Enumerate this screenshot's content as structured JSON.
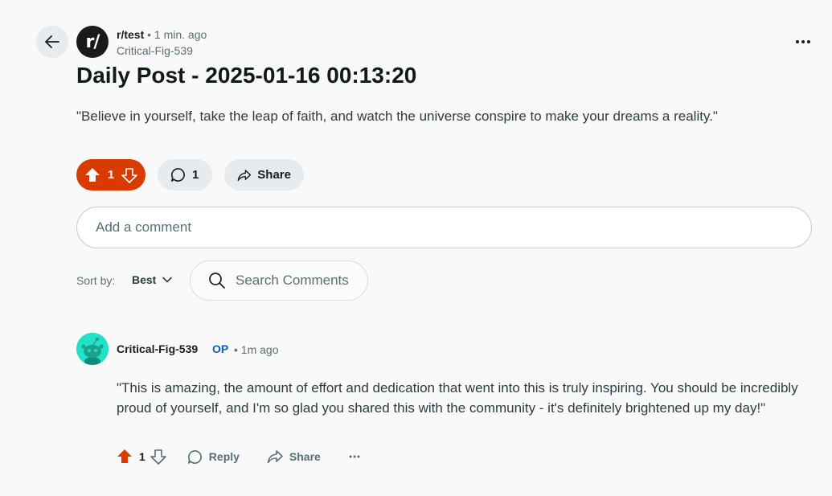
{
  "header": {
    "subreddit": "r/test",
    "separator": "•",
    "time": "1 min. ago",
    "author": "Critical-Fig-539",
    "avatar_text": "r/"
  },
  "post": {
    "title": "Daily Post - 2025-01-16 00:13:20",
    "body": "\"Believe in yourself, take the leap of faith, and watch the universe conspire to make your dreams a reality.\"",
    "votes": "1",
    "comments": "1",
    "share_label": "Share"
  },
  "comment_input": {
    "placeholder": "Add a comment"
  },
  "sort": {
    "label": "Sort by:",
    "value": "Best"
  },
  "search_comments": {
    "placeholder": "Search Comments"
  },
  "comment": {
    "author": "Critical-Fig-539",
    "op_badge": "OP",
    "separator": "•",
    "time": "1m ago",
    "body": "\"This is amazing, the amount of effort and dedication that went into this is truly inspiring. You should be incredibly proud of yourself, and I'm so glad you shared this with the community - it's definitely brightened up my day!\"",
    "votes": "1",
    "reply_label": "Reply",
    "share_label": "Share"
  },
  "colors": {
    "upvote_active": "#d93a00",
    "pill_bg": "#e5ebee",
    "op_blue": "#0a5fb4",
    "avatar_teal": "#23e0c8"
  },
  "icons": [
    "back-arrow-icon",
    "more-icon",
    "upvote-icon",
    "downvote-icon",
    "comment-icon",
    "share-icon",
    "search-icon",
    "chevron-down-icon",
    "reply-icon",
    "snoo-avatar-icon"
  ]
}
